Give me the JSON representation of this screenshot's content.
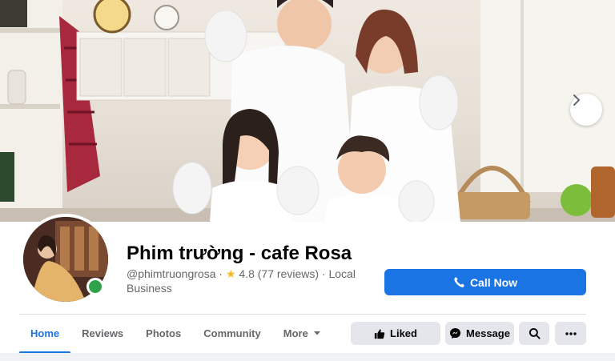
{
  "cover": {
    "next_icon": "chevron-right-icon"
  },
  "page": {
    "name": "Phim trường - cafe Rosa",
    "handle": "@phimtruongrosa",
    "separator": "·",
    "rating": "4.8",
    "reviews": "(77 reviews)",
    "category": "Local Business",
    "online": true
  },
  "call_button": {
    "label": "Call Now",
    "icon": "phone-icon"
  },
  "tabs": [
    {
      "label": "Home",
      "active": true
    },
    {
      "label": "Reviews"
    },
    {
      "label": "Photos"
    },
    {
      "label": "Community"
    },
    {
      "label": "More",
      "icon": "caret-down-icon"
    }
  ],
  "actions": {
    "liked_label": "Liked",
    "liked_icon": "thumbs-up-icon",
    "message_label": "Message",
    "message_icon": "messenger-icon",
    "search_icon": "search-icon",
    "more_icon": "more-options-icon"
  },
  "colors": {
    "accent": "#1b74e4",
    "online": "#31a24c",
    "star": "#f7b928"
  }
}
